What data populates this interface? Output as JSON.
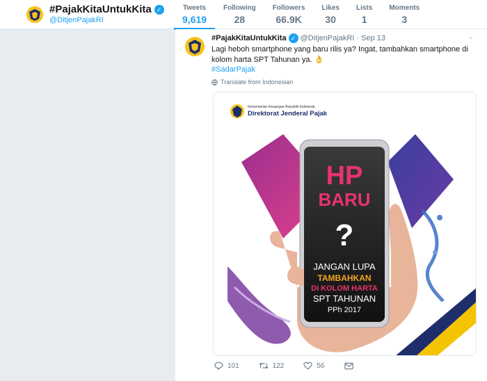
{
  "profile": {
    "name": "#PajakKitaUntukKita",
    "handle": "@DitjenPajakRI"
  },
  "nav": [
    {
      "label": "Tweets",
      "value": "9,619",
      "active": true
    },
    {
      "label": "Following",
      "value": "28"
    },
    {
      "label": "Followers",
      "value": "66.9K"
    },
    {
      "label": "Likes",
      "value": "30"
    },
    {
      "label": "Lists",
      "value": "1"
    },
    {
      "label": "Moments",
      "value": "3"
    }
  ],
  "tweet": {
    "name": "#PajakKitaUntukKita",
    "handle": "@DitjenPajakRI",
    "date": "· Sep 13",
    "text": "Lagi heboh smartphone yang baru rilis ya? Ingat, tambahkan smartphone di kolom harta SPT Tahunan ya.",
    "emoji": "👌",
    "hashtag": "#SadarPajak",
    "translate": "Translate from Indonesian",
    "image": {
      "org_small": "Kementerian Keuangan Republik Indonesia",
      "org_big": "Direktorat Jenderal Pajak",
      "line1": "HP",
      "line2": "BARU",
      "question": "?",
      "l3": "JANGAN LUPA",
      "l4": "TAMBAHKAN",
      "l5": "DI KOLOM HARTA",
      "l6": "SPT TAHUNAN",
      "l7": "PPh 2017"
    },
    "replies": "101",
    "retweets": "122",
    "likes": "56"
  },
  "colors": {
    "accent": "#1da1f2",
    "background": "#e6ecf0",
    "hp_pink": "#e8336d",
    "tambah_orange": "#f5a623"
  }
}
